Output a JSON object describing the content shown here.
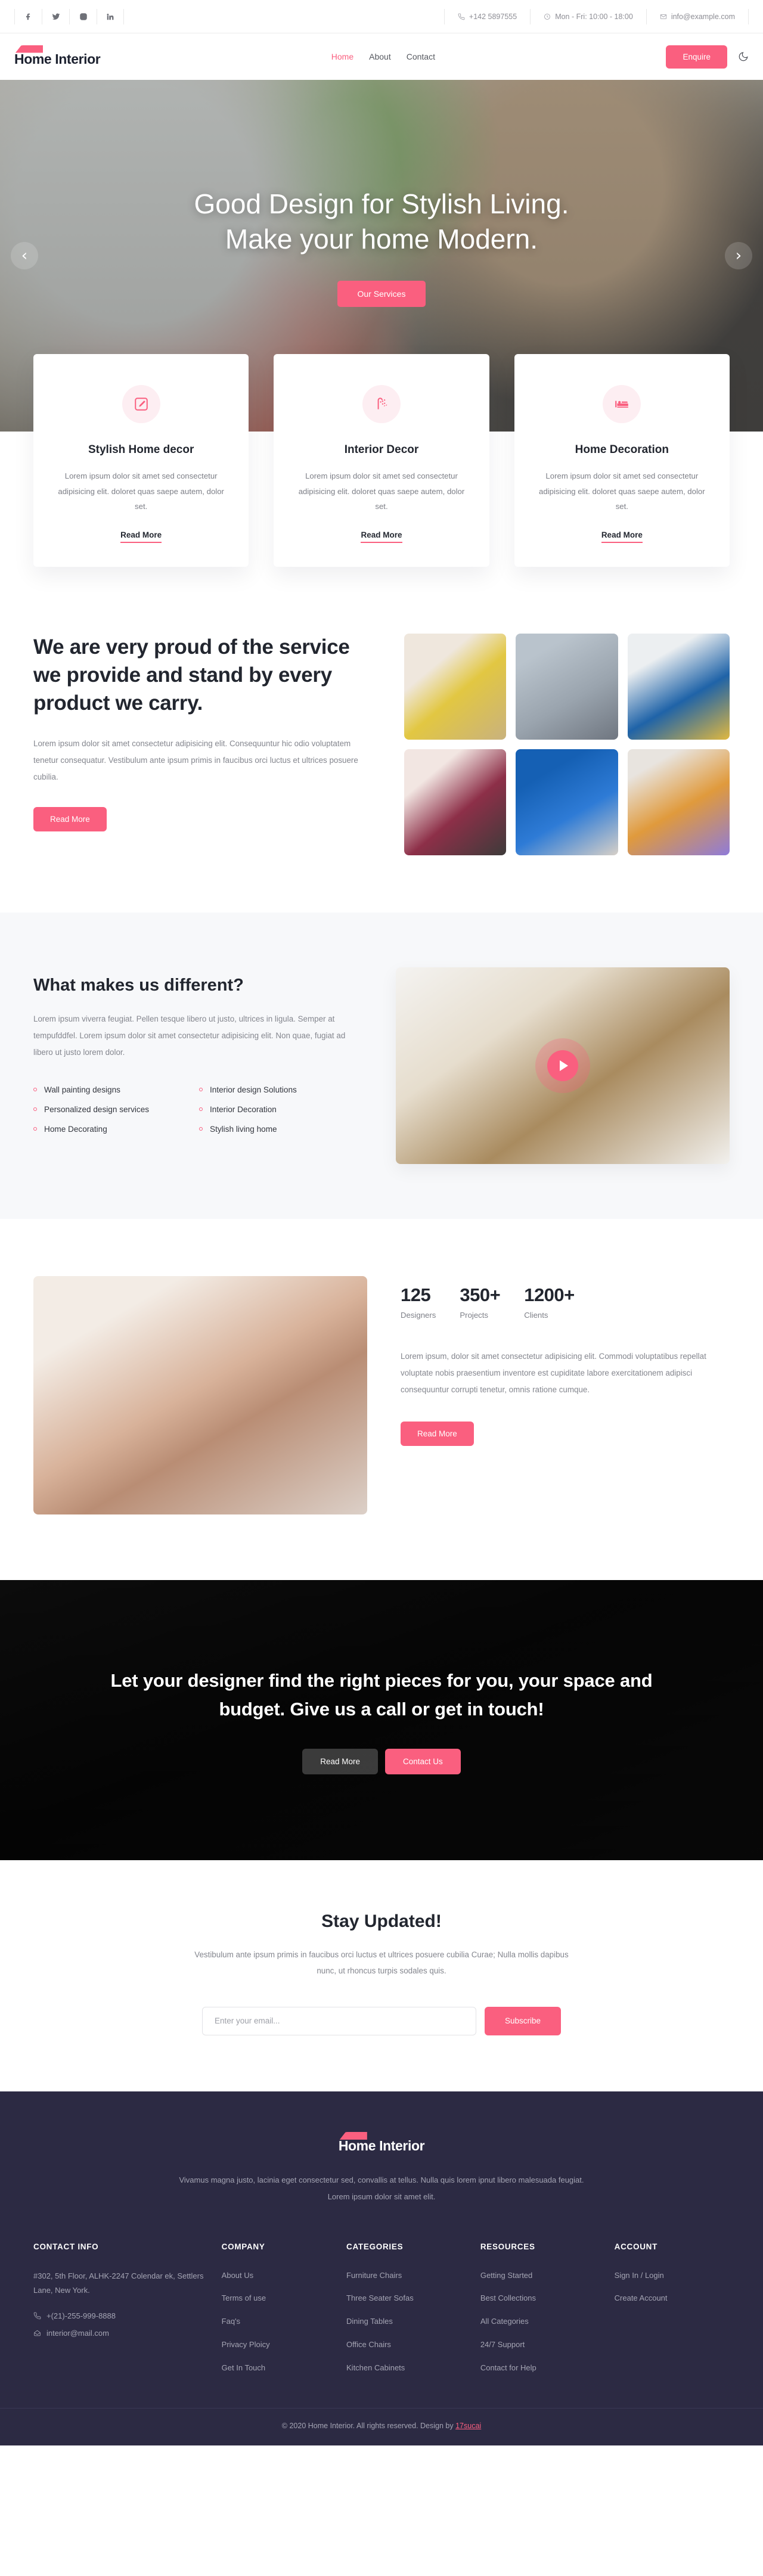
{
  "topbar": {
    "social": [
      {
        "name": "facebook-icon",
        "label": "Facebook"
      },
      {
        "name": "twitter-icon",
        "label": "Twitter"
      },
      {
        "name": "instagram-icon",
        "label": "Instagram"
      },
      {
        "name": "linkedin-icon",
        "label": "LinkedIn"
      }
    ],
    "phone": "+142 5897555",
    "hours": "Mon - Fri: 10:00 - 18:00",
    "email": "info@example.com"
  },
  "nav": {
    "brand": "Home Interior",
    "links": [
      {
        "label": "Home",
        "active": true
      },
      {
        "label": "About",
        "active": false
      },
      {
        "label": "Contact",
        "active": false
      }
    ],
    "enquire_label": "Enquire",
    "theme_toggle": "moon-icon"
  },
  "hero": {
    "title_line1": "Good Design for Stylish Living.",
    "title_line2": "Make your home Modern.",
    "cta_label": "Our Services",
    "prev_label": "‹",
    "next_label": "›"
  },
  "services": [
    {
      "icon": "pencil-square-icon",
      "title": "Stylish Home decor",
      "text": "Lorem ipsum dolor sit amet sed consectetur adipisicing elit. doloret quas saepe autem, dolor set.",
      "link": "Read More"
    },
    {
      "icon": "shower-icon",
      "title": "Interior Decor",
      "text": "Lorem ipsum dolor sit amet sed consectetur adipisicing elit. doloret quas saepe autem, dolor set.",
      "link": "Read More"
    },
    {
      "icon": "bed-icon",
      "title": "Home Decoration",
      "text": "Lorem ipsum dolor sit amet sed consectetur adipisicing elit. doloret quas saepe autem, dolor set.",
      "link": "Read More"
    }
  ],
  "proud": {
    "heading": "We are very proud of the service we provide and stand by every product we carry.",
    "text": "Lorem ipsum dolor sit amet consectetur adipisicing elit. Consequuntur hic odio voluptatem tenetur consequatur. Vestibulum ante ipsum primis in faucibus orci luctus et ultrices posuere cubilia.",
    "button": "Read More",
    "gallery": [
      "yellow-armchairs-living-room",
      "grey-sofa-coffee-table",
      "blue-sofa-arc-lamp",
      "maroon-armchair-shelving",
      "blue-wall-lamp-nightstand",
      "tan-butterfly-chair-pillow"
    ]
  },
  "different": {
    "heading": "What makes us different?",
    "text": "Lorem ipsum viverra feugiat. Pellen tesque libero ut justo, ultrices in ligula. Semper at tempufddfel. Lorem ipsum dolor sit amet consectetur adipisicing elit. Non quae, fugiat ad libero ut justo lorem dolor.",
    "features": [
      "Wall painting designs",
      "Interior design Solutions",
      "Personalized design services",
      "Interior Decoration",
      "Home Decorating",
      "Stylish living home"
    ],
    "video_label": "play-video"
  },
  "stats": {
    "items": [
      {
        "number": "125",
        "label": "Designers"
      },
      {
        "number": "350+",
        "label": "Projects"
      },
      {
        "number": "1200+",
        "label": "Clients"
      }
    ],
    "text": "Lorem ipsum, dolor sit amet consectetur adipisicing elit. Commodi voluptatibus repellat voluptate nobis praesentium inventore est cupiditate labore exercitationem adipisci consequuntur corrupti tenetur, omnis ratione cumque.",
    "button": "Read More",
    "image": "living-room-sofa-plants"
  },
  "cta": {
    "heading": "Let your designer find the right pieces for you, your space and budget. Give us a call or get in touch!",
    "button_secondary": "Read More",
    "button_primary": "Contact Us"
  },
  "newsletter": {
    "heading": "Stay Updated!",
    "text": "Vestibulum ante ipsum primis in faucibus orci luctus et ultrices posuere cubilia Curae; Nulla mollis dapibus nunc, ut rhoncus turpis sodales quis.",
    "placeholder": "Enter your email...",
    "value": "",
    "button": "Subscribe"
  },
  "footer": {
    "brand": "Home Interior",
    "about": "Vivamus magna justo, lacinia eget consectetur sed, convallis at tellus. Nulla quis lorem ipnut libero malesuada feugiat. Lorem ipsum dolor sit amet elit.",
    "contact": {
      "title": "CONTACT INFO",
      "address": "#302, 5th Floor, ALHK-2247 Colendar ek, Settlers Lane, New York.",
      "phone": "+(21)-255-999-8888",
      "email": "interior@mail.com"
    },
    "columns": [
      {
        "title": "COMPANY",
        "links": [
          "About Us",
          "Terms of use",
          "Faq's",
          "Privacy Ploicy",
          "Get In Touch"
        ]
      },
      {
        "title": "CATEGORIES",
        "links": [
          "Furniture Chairs",
          "Three Seater Sofas",
          "Dining Tables",
          "Office Chairs",
          "Kitchen Cabinets"
        ]
      },
      {
        "title": "RESOURCES",
        "links": [
          "Getting Started",
          "Best Collections",
          "All Categories",
          "24/7 Support",
          "Contact for Help"
        ]
      },
      {
        "title": "ACCOUNT",
        "links": [
          "Sign In / Login",
          "Create Account"
        ]
      }
    ],
    "copyright_prefix": "© 2020 Home Interior. All rights reserved. Design by ",
    "copyright_link": "17sucai"
  },
  "colors": {
    "accent": "#fa5f7f",
    "accent_soft": "#fdeef2",
    "heading": "#22262f",
    "body_text": "#84868e",
    "footer_bg": "#2c2a43",
    "light_bg": "#f7f8fa"
  }
}
